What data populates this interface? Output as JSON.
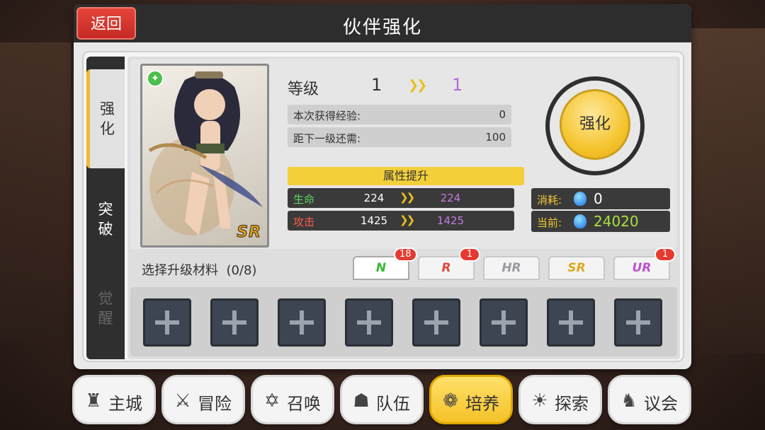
{
  "window": {
    "title": "伙伴强化",
    "back_label": "返回"
  },
  "side_tabs": [
    {
      "label": "强\n化",
      "state": "active"
    },
    {
      "label": "突\n破",
      "state": "normal"
    },
    {
      "label": "觉\n醒",
      "state": "disabled"
    }
  ],
  "card": {
    "element_icon": "wind-element-icon",
    "rarity": "SR"
  },
  "level": {
    "label": "等级",
    "current": "1",
    "arrow": "»",
    "next": "1"
  },
  "exp": {
    "gained_label": "本次获得经验:",
    "gained_value": "0",
    "remaining_label": "距下一级还需:",
    "remaining_value": "100"
  },
  "attributes": {
    "header": "属性提升",
    "rows": [
      {
        "name": "生命",
        "name_color": "#5cd65c",
        "current": "224",
        "next": "224"
      },
      {
        "name": "攻击",
        "name_color": "#ff5a4a",
        "current": "1425",
        "next": "1425"
      }
    ]
  },
  "enhance_button": {
    "label": "强化"
  },
  "cost": {
    "cost_label": "消耗:",
    "cost_value": "0",
    "cost_color": "#ffffff",
    "current_label": "当前:",
    "current_value": "24020",
    "current_color": "#a8e040"
  },
  "materials": {
    "label": "选择升级材料  (0/8)",
    "rarity_tabs": [
      {
        "label": "N",
        "color": "#3ab83a",
        "badge": "18"
      },
      {
        "label": "R",
        "color": "#e04a3a",
        "badge": "1"
      },
      {
        "label": "HR",
        "color": "#9a9aa0",
        "badge": ""
      },
      {
        "label": "SR",
        "color": "#e0a820",
        "badge": ""
      },
      {
        "label": "UR",
        "color": "#c050d0",
        "badge": "1"
      }
    ],
    "slot_count": 8
  },
  "nav": [
    {
      "label": "主城",
      "icon": "castle-icon",
      "glyph": "♜",
      "active": false
    },
    {
      "label": "冒险",
      "icon": "crossed-swords-icon",
      "glyph": "⚔",
      "active": false
    },
    {
      "label": "召唤",
      "icon": "summon-circle-icon",
      "glyph": "✡",
      "active": false
    },
    {
      "label": "队伍",
      "icon": "team-icon",
      "glyph": "☗",
      "active": false
    },
    {
      "label": "培养",
      "icon": "cultivate-icon",
      "glyph": "❁",
      "active": true
    },
    {
      "label": "探索",
      "icon": "explore-icon",
      "glyph": "☀",
      "active": false
    },
    {
      "label": "议会",
      "icon": "council-icon",
      "glyph": "♞",
      "active": false
    }
  ]
}
